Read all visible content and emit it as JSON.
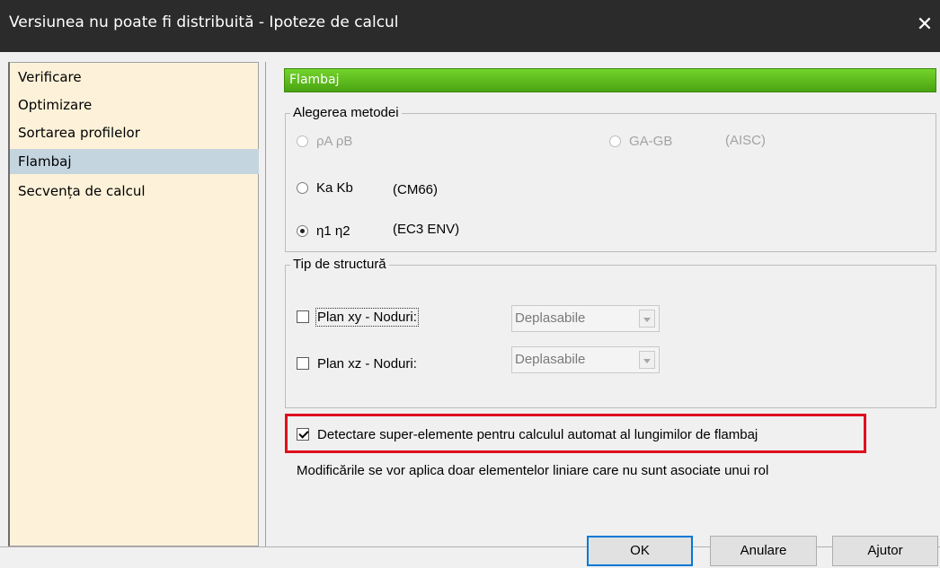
{
  "window": {
    "title": "Versiunea nu poate fi distribuită - Ipoteze de calcul",
    "close_symbol": "✕"
  },
  "sidebar": {
    "items": [
      {
        "label": "Verificare"
      },
      {
        "label": "Optimizare"
      },
      {
        "label": "Sortarea profilelor"
      },
      {
        "label": "Flambaj",
        "selected": true
      },
      {
        "label": "Secvența de calcul"
      }
    ]
  },
  "panel": {
    "header": "Flambaj",
    "method_group": {
      "legend": "Alegerea metodei",
      "options": [
        {
          "label": "ρA ρB",
          "note": "",
          "checked": false,
          "enabled": false
        },
        {
          "label": "GA-GB",
          "note": "(AISC)",
          "checked": false,
          "enabled": false
        },
        {
          "label": "Ka Kb",
          "note": "(CM66)",
          "checked": false,
          "enabled": true
        },
        {
          "label": "η1 η2",
          "note": "(EC3 ENV)",
          "checked": true,
          "enabled": true
        }
      ]
    },
    "structure_group": {
      "legend": "Tip de structură",
      "rows": [
        {
          "label": "Plan xy - Noduri:",
          "checked": false,
          "value": "Deplasabile"
        },
        {
          "label": "Plan xz - Noduri:",
          "checked": false,
          "value": "Deplasabile"
        }
      ]
    },
    "detect_checkbox": {
      "label": "Detectare super-elemente pentru calculul automat al lungimilor de flambaj",
      "checked": true
    },
    "info_text": "Modificările se vor aplica doar elementelor liniare care nu sunt asociate unui rol"
  },
  "buttons": {
    "ok": "OK",
    "cancel": "Anulare",
    "help": "Ajutor"
  },
  "colors": {
    "header_green": "#5cbf1f",
    "selection": "#c5d5e0",
    "sidebar_bg": "#fdf2d9",
    "highlight_red": "#e0101d",
    "title_bar": "#2b2b2b"
  }
}
